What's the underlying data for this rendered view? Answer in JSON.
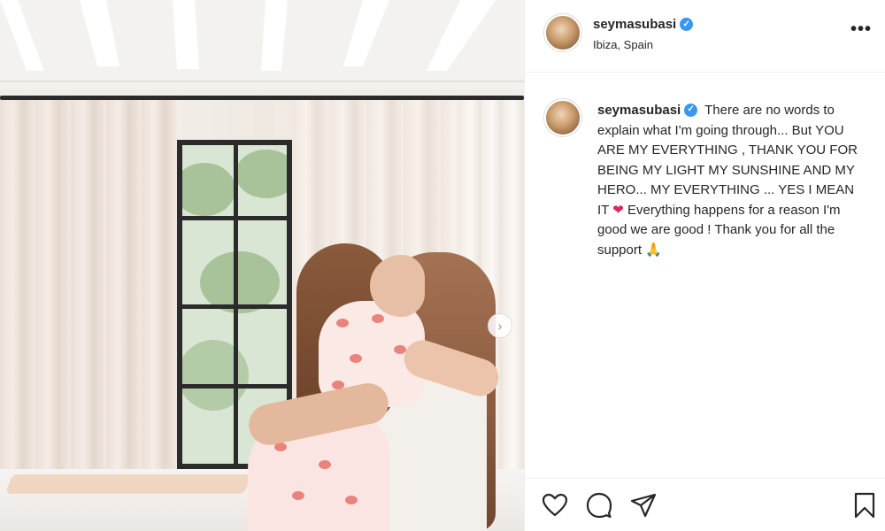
{
  "post": {
    "username": "seymasubasi",
    "location": "Ibiza, Spain",
    "more_label": "•••",
    "verified_mark": "✓",
    "caption": {
      "line1": "There are no words to explain what I'm going through... But YOU ARE MY EVERYTHING , THANK YOU FOR BEING MY LIGHT MY SUNSHINE AND MY HERO... MY EVERYTHING ... YES I MEAN IT",
      "heart": "❤",
      "line2": "Everything happens for a reason I'm good we are good ! Thank you for all the support",
      "pray": "🙏"
    },
    "carousel_next": "›"
  },
  "icons": {
    "like": "heart-icon",
    "comment": "comment-icon",
    "share": "share-icon",
    "save": "bookmark-icon",
    "verified": "verified-badge-icon",
    "more": "more-options-icon"
  },
  "colors": {
    "verified": "#3897f0",
    "text": "#262626",
    "divider": "#efefef"
  }
}
